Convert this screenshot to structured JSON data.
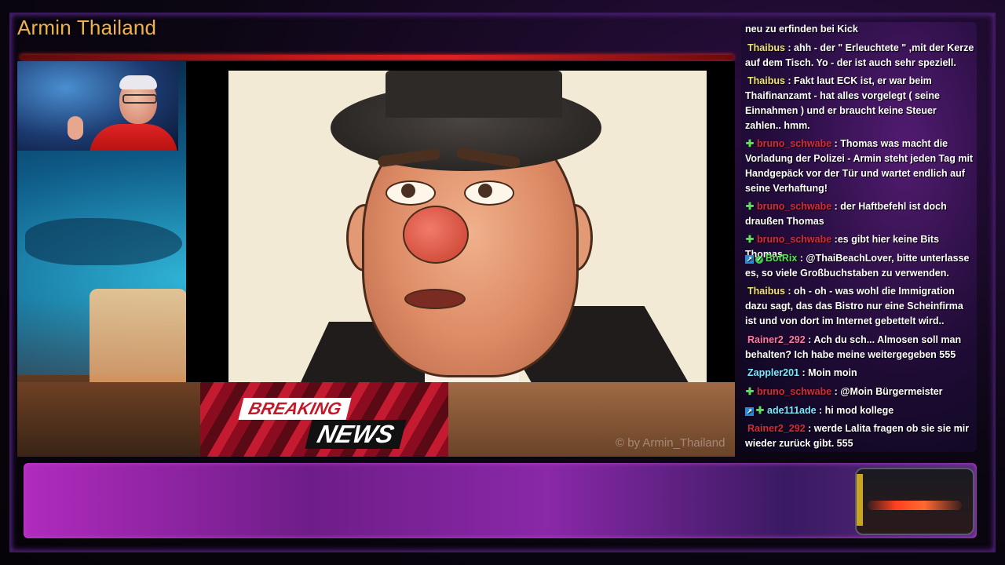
{
  "header": {
    "channel_title": "Armin Thailand"
  },
  "video": {
    "breaking_word": "BREAKING",
    "news_word": "NEWS",
    "watermark": "© by Armin_Thailand"
  },
  "chat": {
    "messages": [
      {
        "user": "",
        "text": "neu zu erfinden bei Kick"
      },
      {
        "user": "Thaibus",
        "sep": " : ",
        "text": "ahh - der \" Erleuchtete \" ,mit der Kerze auf dem Tisch. Yo - der ist auch sehr speziell."
      },
      {
        "user": "Thaibus",
        "sep": " : ",
        "text": "Fakt laut ECK ist, er war beim Thaifinanzamt - hat alles vorgelegt ( seine Einnahmen ) und er braucht keine Steuer zahlen.. hmm."
      },
      {
        "user": "bruno_schwabe",
        "sep": " : ",
        "text": "Thomas was macht die Vorladung der Polizei - Armin steht jeden Tag mit Handgepäck vor der Tür und wartet endlich auf seine Verhaftung!"
      },
      {
        "user": "bruno_schwabe",
        "sep": " : ",
        "text": "der Haftbefehl ist doch draußen Thomas"
      },
      {
        "user": "bruno_schwabe",
        "sep": " :",
        "text": "es gibt hier keine Bits Thomas"
      },
      {
        "user": "BotRix",
        "sep": " : ",
        "text": "@ThaiBeachLover, bitte unterlasse es, so viele Großbuchstaben zu verwenden."
      },
      {
        "user": "Thaibus",
        "sep": " : ",
        "text": "oh - oh - was wohl die Immigration dazu sagt, das das Bistro nur eine Scheinfirma ist und von dort im Internet gebettelt wird.."
      },
      {
        "user": "Rainer2_292",
        "sep": " : ",
        "text": "Ach du sch... Almosen soll man behalten? Ich habe meine weitergegeben 555"
      },
      {
        "user": "Zappler201",
        "sep": " : ",
        "text": "Moin moin"
      },
      {
        "user": "bruno_schwabe",
        "sep": " : ",
        "text": "@Moin Bürgermeister"
      },
      {
        "user": "ade111ade",
        "sep": " : ",
        "text": "hi mod kollege"
      },
      {
        "user": "Rainer2_292",
        "sep": " : ",
        "text": "werde Lalita fragen ob sie sie mir wieder zurück gibt. 555"
      }
    ]
  },
  "colors": {
    "accent_title": "#f2b24a",
    "bottom_bar": "#8a28a8"
  }
}
